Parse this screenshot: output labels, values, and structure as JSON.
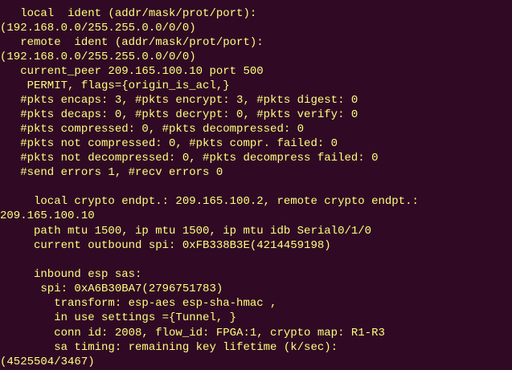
{
  "terminal": {
    "lines": [
      "   local  ident (addr/mask/prot/port):",
      "(192.168.0.0/255.255.0.0/0/0)",
      "   remote  ident (addr/mask/prot/port):",
      "(192.168.0.0/255.255.0.0/0/0)",
      "   current_peer 209.165.100.10 port 500",
      "    PERMIT, flags={origin_is_acl,}",
      "   #pkts encaps: 3, #pkts encrypt: 3, #pkts digest: 0",
      "   #pkts decaps: 0, #pkts decrypt: 0, #pkts verify: 0",
      "   #pkts compressed: 0, #pkts decompressed: 0",
      "   #pkts not compressed: 0, #pkts compr. failed: 0",
      "   #pkts not decompressed: 0, #pkts decompress failed: 0",
      "   #send errors 1, #recv errors 0",
      "",
      "     local crypto endpt.: 209.165.100.2, remote crypto endpt.:",
      "209.165.100.10",
      "     path mtu 1500, ip mtu 1500, ip mtu idb Serial0/1/0",
      "     current outbound spi: 0xFB338B3E(4214459198)",
      "",
      "     inbound esp sas:",
      "      spi: 0xA6B30BA7(2796751783)",
      "        transform: esp-aes esp-sha-hmac ,",
      "        in use settings ={Tunnel, }",
      "        conn id: 2008, flow_id: FPGA:1, crypto map: R1-R3",
      "        sa timing: remaining key lifetime (k/sec):",
      "(4525504/3467)"
    ]
  }
}
